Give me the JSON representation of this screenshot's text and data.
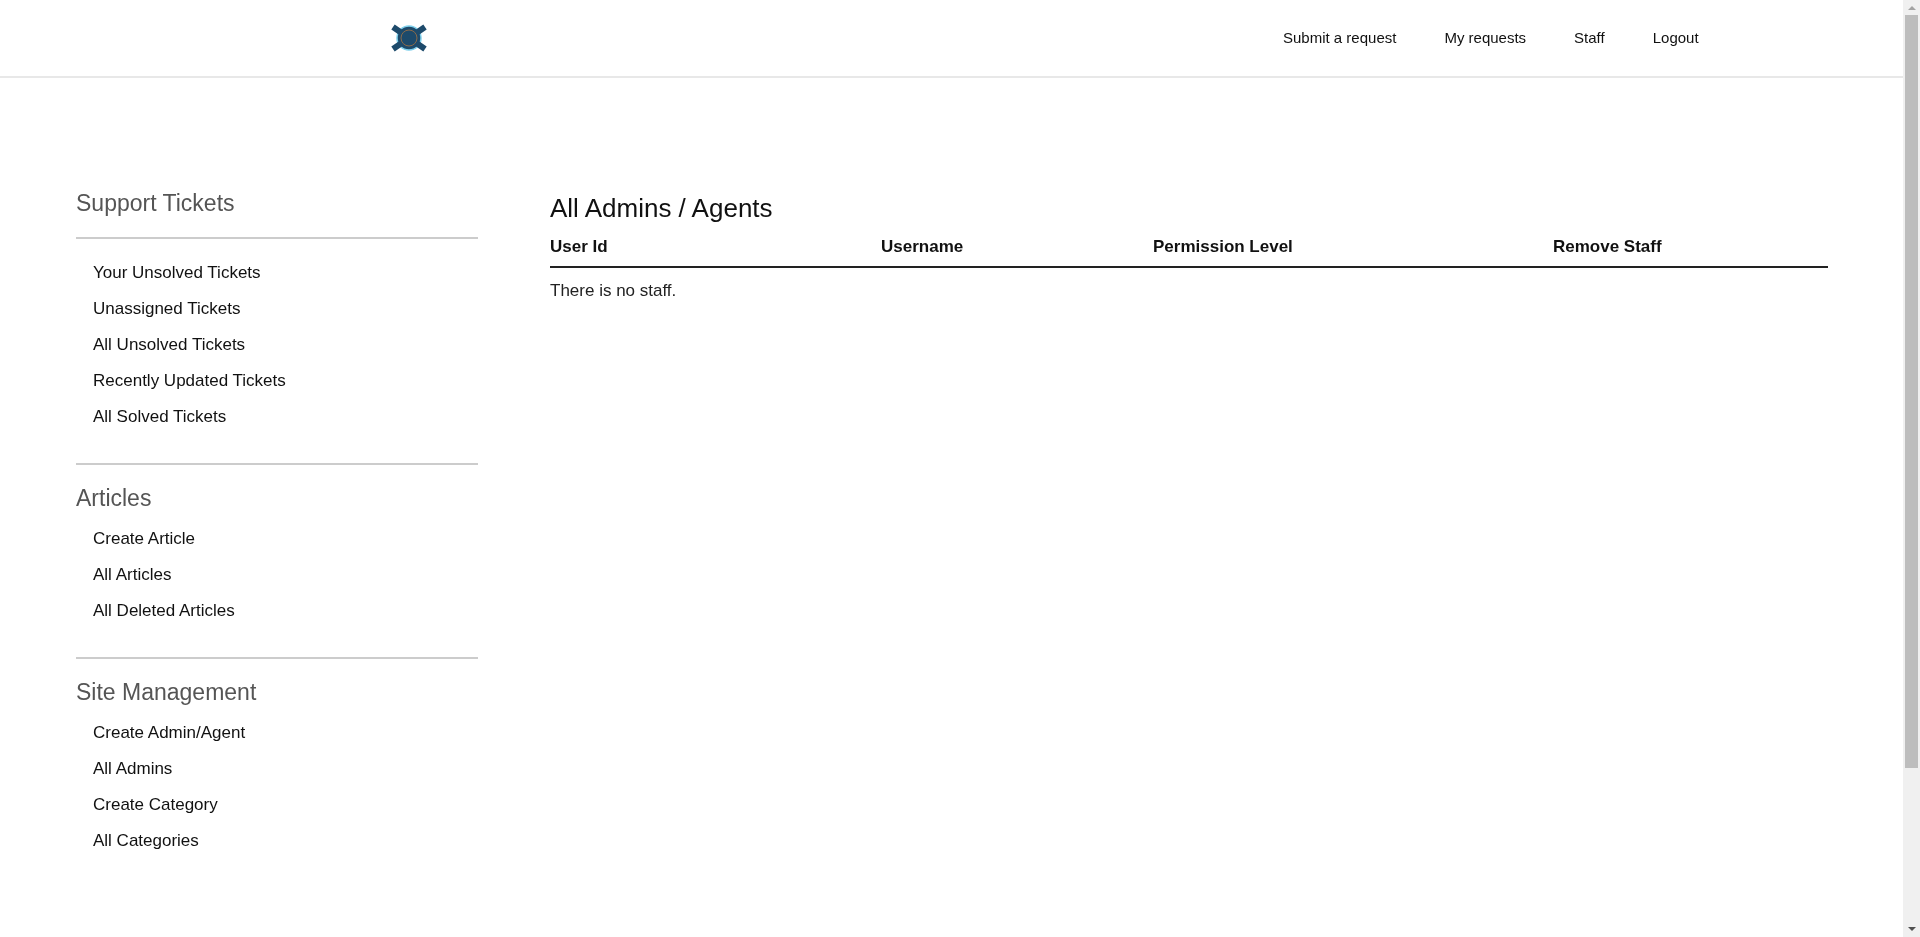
{
  "nav": {
    "links": [
      "Submit a request",
      "My requests",
      "Staff",
      "Logout"
    ]
  },
  "sidebar": {
    "sections": [
      {
        "title": "Support Tickets",
        "items": [
          "Your Unsolved Tickets",
          "Unassigned Tickets",
          "All Unsolved Tickets",
          "Recently Updated Tickets",
          "All Solved Tickets"
        ]
      },
      {
        "title": "Articles",
        "items": [
          "Create Article",
          "All Articles",
          "All Deleted Articles"
        ]
      },
      {
        "title": "Site Management",
        "items": [
          "Create Admin/Agent",
          "All Admins",
          "Create Category",
          "All Categories"
        ]
      }
    ]
  },
  "main": {
    "title": "All Admins / Agents",
    "table": {
      "columns": [
        "User Id",
        "Username",
        "Permission Level",
        "Remove Staff"
      ],
      "empty_message": "There is no staff."
    }
  }
}
